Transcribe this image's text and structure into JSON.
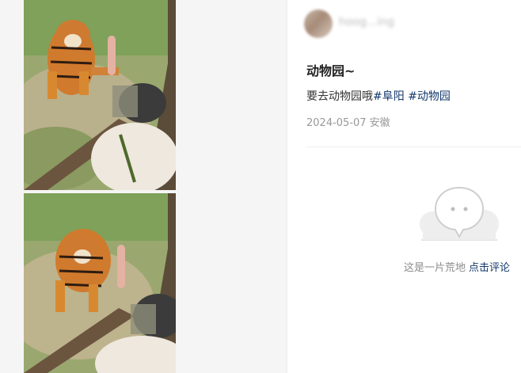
{
  "post": {
    "author_name": "hoog...ing",
    "title": "动物园~",
    "text": "要去动物园哦",
    "tags": [
      "#阜阳",
      "#动物园"
    ],
    "date": "2024-05-07",
    "location": "安徽"
  },
  "comments": {
    "empty_text": "这是一片荒地",
    "cta_label": "点击评论"
  },
  "icons": {
    "empty_state": "chat-bubble-icon"
  },
  "colors": {
    "link": "#13386c",
    "meta": "#999999",
    "title": "#222222"
  }
}
